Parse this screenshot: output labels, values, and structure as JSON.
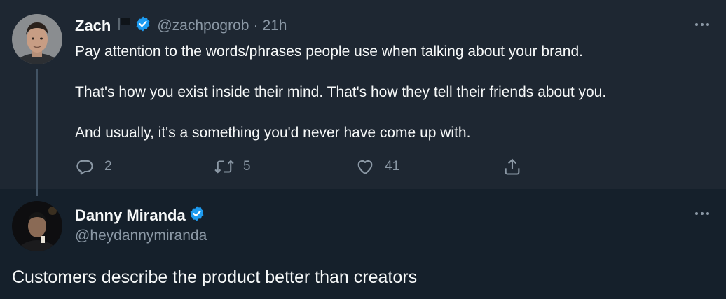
{
  "tweet": {
    "author_name": "Zach",
    "author_handle": "@zachpogrob",
    "separator": "·",
    "time": "21h",
    "paragraphs": [
      "Pay attention to the words/phrases people use when talking about your brand.",
      "That's how you exist inside their mind. That's how they tell their friends about you.",
      "And usually, it's a something you'd never have come up with."
    ],
    "actions": {
      "replies": "2",
      "retweets": "5",
      "likes": "41"
    },
    "more_icon": "more-horizontal-icon"
  },
  "reply": {
    "author_name": "Danny Miranda",
    "author_handle": "@heydannymiranda",
    "text": "Customers describe the product better than creators",
    "more_icon": "more-horizontal-icon"
  },
  "colors": {
    "background": "#15202b",
    "highlight_background": "#1e2732",
    "text_primary": "#f7f9f9",
    "text_secondary": "#8b98a5",
    "verified_blue": "#1d9bf0",
    "thread_line": "#425364"
  }
}
